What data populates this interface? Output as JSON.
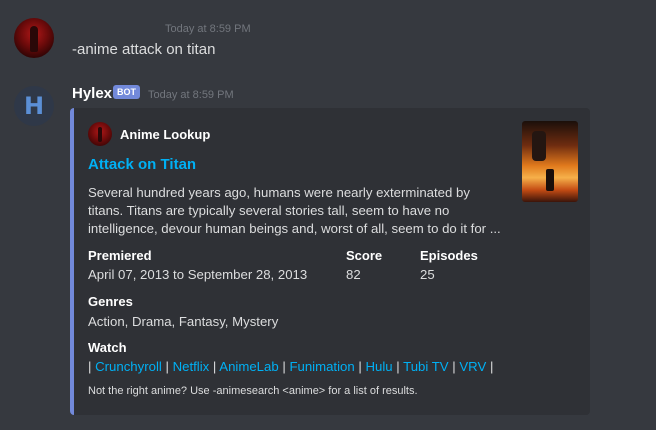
{
  "message1": {
    "timestamp": "Today at 8:59 PM",
    "content": "-anime attack on titan"
  },
  "message2": {
    "author": "Hylex",
    "badge": "BOT",
    "timestamp": "Today at 8:59 PM",
    "avatar_letter": "H"
  },
  "embed": {
    "accent_color": "#7289da",
    "author_name": "Anime Lookup",
    "title": "Attack on Titan",
    "description": "Several hundred years ago, humans were nearly exterminated by titans. Titans are typically several stories tall, seem to have no intelligence, devour human beings and, worst of all, seem to do it for ...",
    "fields": {
      "premiered": {
        "name": "Premiered",
        "value": "April 07, 2013 to September 28, 2013"
      },
      "score": {
        "name": "Score",
        "value": "82"
      },
      "episodes": {
        "name": "Episodes",
        "value": "25"
      },
      "genres": {
        "name": "Genres",
        "value": "Action, Drama, Fantasy, Mystery"
      },
      "watch": {
        "name": "Watch",
        "separator": "|",
        "links": [
          "Crunchyroll",
          "Netflix",
          "AnimeLab",
          "Funimation",
          "Hulu",
          "Tubi TV",
          "VRV"
        ]
      }
    },
    "footer": "Not the right anime? Use -animesearch <anime> for a list of results."
  }
}
